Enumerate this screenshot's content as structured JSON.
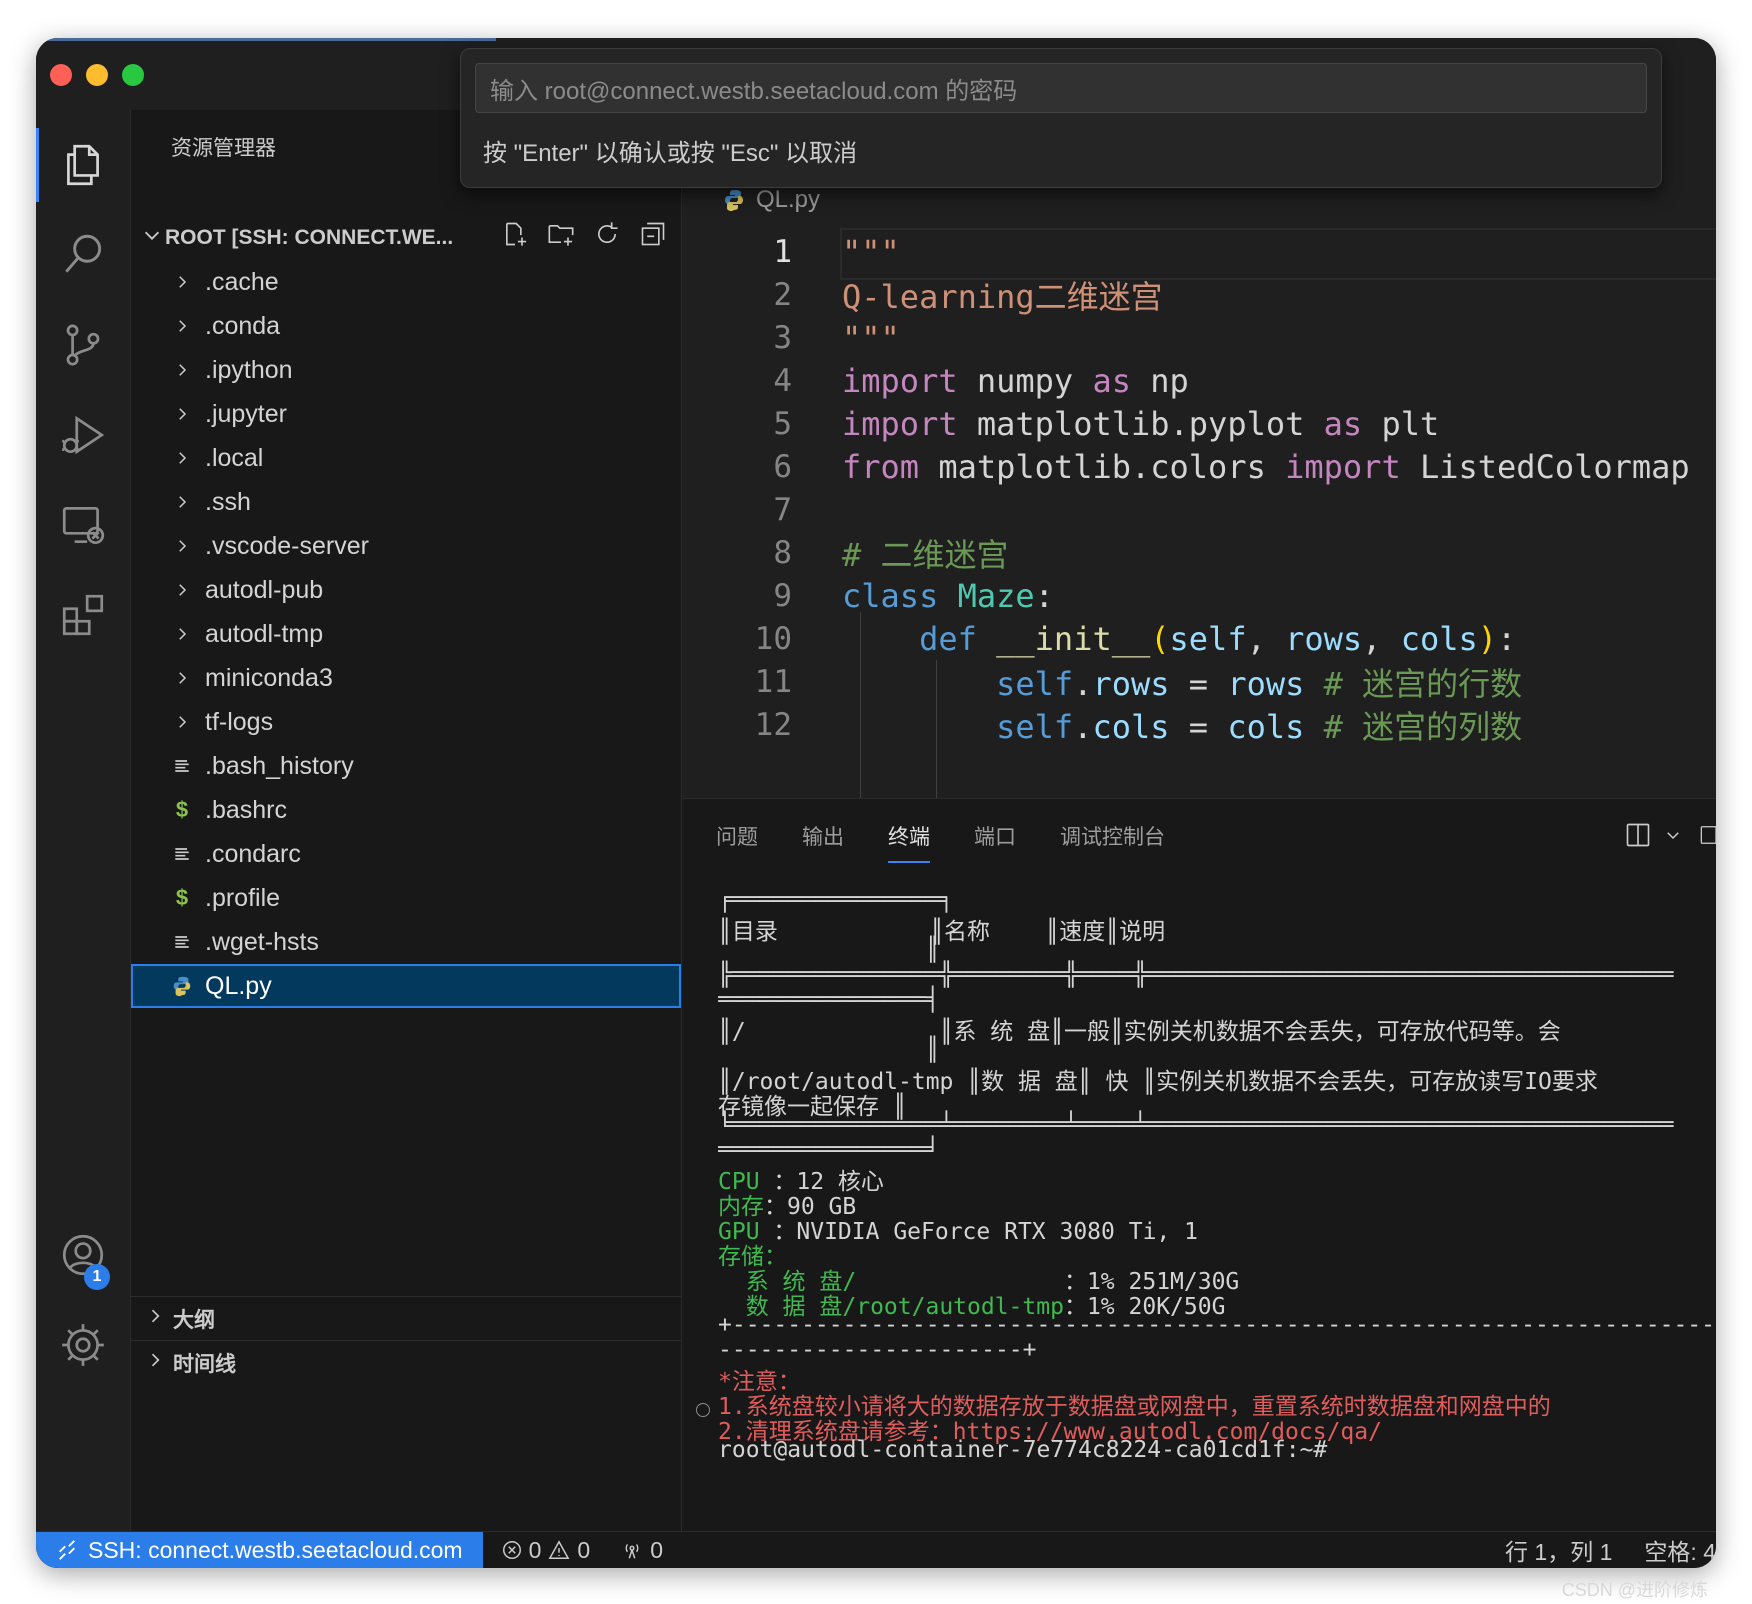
{
  "window": {
    "traffic_lights": [
      "#fe5f57",
      "#febc2e",
      "#28c840"
    ]
  },
  "quick_input": {
    "placeholder": "输入 root@connect.westb.seetacloud.com 的密码",
    "hint": "按 \"Enter\" 以确认或按 \"Esc\" 以取消"
  },
  "activity_bar": {
    "items": [
      {
        "icon": "files-icon"
      },
      {
        "icon": "search-icon"
      },
      {
        "icon": "source-control-icon"
      },
      {
        "icon": "run-debug-icon"
      },
      {
        "icon": "remote-explorer-icon"
      },
      {
        "icon": "extensions-icon"
      }
    ],
    "accounts_badge": "1"
  },
  "sidebar": {
    "title": "资源管理器",
    "root_label": "ROOT [SSH: CONNECT.WE...",
    "items": [
      {
        "label": ".cache",
        "kind": "folder"
      },
      {
        "label": ".conda",
        "kind": "folder"
      },
      {
        "label": ".ipython",
        "kind": "folder"
      },
      {
        "label": ".jupyter",
        "kind": "folder"
      },
      {
        "label": ".local",
        "kind": "folder"
      },
      {
        "label": ".ssh",
        "kind": "folder"
      },
      {
        "label": ".vscode-server",
        "kind": "folder"
      },
      {
        "label": "autodl-pub",
        "kind": "folder"
      },
      {
        "label": "autodl-tmp",
        "kind": "folder"
      },
      {
        "label": "miniconda3",
        "kind": "folder"
      },
      {
        "label": "tf-logs",
        "kind": "folder"
      },
      {
        "label": ".bash_history",
        "kind": "text"
      },
      {
        "label": ".bashrc",
        "kind": "shell"
      },
      {
        "label": ".condarc",
        "kind": "text"
      },
      {
        "label": ".profile",
        "kind": "shell"
      },
      {
        "label": ".wget-hsts",
        "kind": "text"
      },
      {
        "label": "QL.py",
        "kind": "python",
        "selected": true
      }
    ],
    "outline_label": "大纲",
    "timeline_label": "时间线"
  },
  "editor": {
    "tab_label": "QL.py",
    "current_line": 1,
    "lines": [
      {
        "n": "1",
        "tokens": [
          [
            "str",
            "\"\"\""
          ]
        ]
      },
      {
        "n": "2",
        "tokens": [
          [
            "str",
            "Q-learning二维迷宫"
          ]
        ]
      },
      {
        "n": "3",
        "tokens": [
          [
            "str",
            "\"\"\""
          ]
        ]
      },
      {
        "n": "4",
        "tokens": [
          [
            "kw",
            "import"
          ],
          [
            "plain",
            " numpy "
          ],
          [
            "kw",
            "as"
          ],
          [
            "plain",
            " np"
          ]
        ]
      },
      {
        "n": "5",
        "tokens": [
          [
            "kw",
            "import"
          ],
          [
            "plain",
            " matplotlib.pyplot "
          ],
          [
            "kw",
            "as"
          ],
          [
            "plain",
            " plt"
          ]
        ]
      },
      {
        "n": "6",
        "tokens": [
          [
            "kw",
            "from"
          ],
          [
            "plain",
            " matplotlib.colors "
          ],
          [
            "kw",
            "import"
          ],
          [
            "plain",
            " ListedColormap"
          ]
        ]
      },
      {
        "n": "7",
        "tokens": []
      },
      {
        "n": "8",
        "tokens": [
          [
            "com",
            "# 二维迷宫"
          ]
        ]
      },
      {
        "n": "9",
        "tokens": [
          [
            "def",
            "class"
          ],
          [
            "plain",
            " "
          ],
          [
            "cls",
            "Maze"
          ],
          [
            "plain",
            ":"
          ]
        ]
      },
      {
        "n": "10",
        "tokens": [
          [
            "plain",
            "    "
          ],
          [
            "def",
            "def"
          ],
          [
            "plain",
            " "
          ],
          [
            "fn",
            "__init__"
          ],
          [
            "paren",
            "("
          ],
          [
            "var",
            "self"
          ],
          [
            "plain",
            ", "
          ],
          [
            "var",
            "rows"
          ],
          [
            "plain",
            ", "
          ],
          [
            "var",
            "cols"
          ],
          [
            "paren",
            ")"
          ],
          [
            "plain",
            ":"
          ]
        ]
      },
      {
        "n": "11",
        "tokens": [
          [
            "plain",
            "        "
          ],
          [
            "self",
            "self"
          ],
          [
            "plain",
            "."
          ],
          [
            "var",
            "rows"
          ],
          [
            "plain",
            " = "
          ],
          [
            "var",
            "rows"
          ],
          [
            "plain",
            " "
          ],
          [
            "com",
            "# 迷宫的行数"
          ]
        ]
      },
      {
        "n": "12",
        "tokens": [
          [
            "plain",
            "        "
          ],
          [
            "self",
            "self"
          ],
          [
            "plain",
            "."
          ],
          [
            "var",
            "cols"
          ],
          [
            "plain",
            " = "
          ],
          [
            "var",
            "cols"
          ],
          [
            "plain",
            " "
          ],
          [
            "com",
            "# 迷宫的列数"
          ]
        ]
      }
    ]
  },
  "panel": {
    "tabs": [
      "问题",
      "输出",
      "终端",
      "端口",
      "调试控制台"
    ],
    "active_tab": "终端",
    "terminal": [
      {
        "text": "╒═══════════════╕",
        "cls": ""
      },
      {
        "text": "║目录           ║名称    ║速度║说明",
        "cls": ""
      },
      {
        "text": "               ║",
        "cls": ""
      },
      {
        "text": "╠═══════════════╬════════╬════╬══════════════════════════════════════",
        "cls": ""
      },
      {
        "text": "═══════════════╡",
        "cls": ""
      },
      {
        "text": "║/              ║系 统 盘║一般║实例关机数据不会丢失，可存放代码等。会",
        "cls": ""
      },
      {
        "text": "               ║",
        "cls": ""
      },
      {
        "text": "║/root/autodl-tmp ║数 据 盘║ 快 ║实例关机数据不会丢失，可存放读写IO要求",
        "cls": ""
      },
      {
        "text": "存镜像一起保存 ║",
        "cls": ""
      },
      {
        "text": "╘═══════════════╧════════╧════╧══════════════════════════════════════",
        "cls": ""
      },
      {
        "text": "═══════════════╛",
        "cls": ""
      },
      {
        "text": "CPU ：12 核心",
        "cls": "cpu"
      },
      {
        "text": "内存：90 GB",
        "cls": "mem"
      },
      {
        "text": "GPU ：NVIDIA GeForce RTX 3080 Ti, 1",
        "cls": "gpu"
      },
      {
        "text": "存储：",
        "cls": "green"
      },
      {
        "text": "  系 统 盘/               ：1% 251M/30G",
        "cls": "sys"
      },
      {
        "text": "  数 据 盘/root/autodl-tmp：1% 20K/50G",
        "cls": "data"
      },
      {
        "text": "+------------------------------------------------------------------------",
        "cls": ""
      },
      {
        "text": "----------------------+",
        "cls": ""
      },
      {
        "text": "*注意：",
        "cls": "red"
      },
      {
        "text": "1.系统盘较小请将大的数据存放于数据盘或网盘中，重置系统时数据盘和网盘中的",
        "cls": "red"
      },
      {
        "text": "2.清理系统盘请参考：https://www.autodl.com/docs/qa/",
        "cls": "red"
      },
      {
        "text": "root@autodl-container-7e774c8224-ca01cd1f:~#",
        "cls": "prompt"
      }
    ]
  },
  "statusbar": {
    "remote_label": "SSH: connect.westb.seetacloud.com",
    "errors": "0",
    "warnings": "0",
    "ports": "0",
    "position": "行 1，列 1",
    "spaces": "空格: 4"
  },
  "watermark": "CSDN @进阶修炼"
}
